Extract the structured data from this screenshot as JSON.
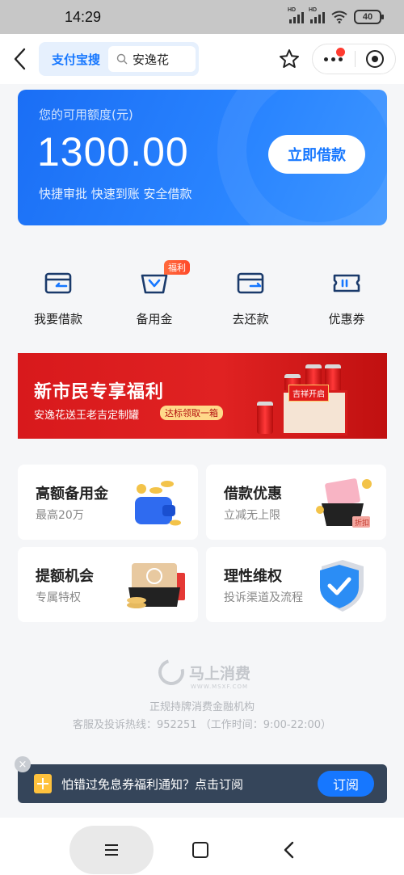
{
  "status_bar": {
    "time": "14:29",
    "battery": "40",
    "signal_label": "HD"
  },
  "nav": {
    "brand": "支付宝搜",
    "search_value": "安逸花",
    "icons": [
      "back-arrow-icon",
      "search-icon",
      "star-icon",
      "more-icon",
      "close-miniapp-icon"
    ]
  },
  "credit": {
    "label": "您的可用额度(元)",
    "amount": "1300.00",
    "features": "快捷审批 快速到账 安全借款",
    "button": "立即借款"
  },
  "quick_actions": [
    {
      "label": "我要借款",
      "icon": "wallet-icon"
    },
    {
      "label": "备用金",
      "icon": "basket-icon",
      "badge": "福利"
    },
    {
      "label": "去还款",
      "icon": "repay-icon"
    },
    {
      "label": "优惠券",
      "icon": "ticket-icon"
    }
  ],
  "banner": {
    "title": "新市民专享福利",
    "subtitle": "安逸花送王老吉定制罐",
    "tag": "达标领取一箱",
    "box_label": "吉祥开启"
  },
  "features": [
    {
      "title": "高额备用金",
      "sub": "最高20万"
    },
    {
      "title": "借款优惠",
      "sub": "立减无上限",
      "tag": "折扣"
    },
    {
      "title": "提额机会",
      "sub": "专属特权"
    },
    {
      "title": "理性维权",
      "sub": "投诉渠道及流程"
    }
  ],
  "footer": {
    "brand": "马上消费",
    "url": "WWW.MSXF.COM",
    "line1": "正规持牌消费金融机构",
    "line2": "客服及投诉热线：952251 （工作时间：9:00-22:00）"
  },
  "subscribe": {
    "text": "怕错过免息券福利通知？点击订阅",
    "button": "订阅",
    "close": "×"
  },
  "colors": {
    "accent": "#1677ff",
    "banner_red": "#d8191c",
    "subscribe_bg": "#35455a"
  }
}
